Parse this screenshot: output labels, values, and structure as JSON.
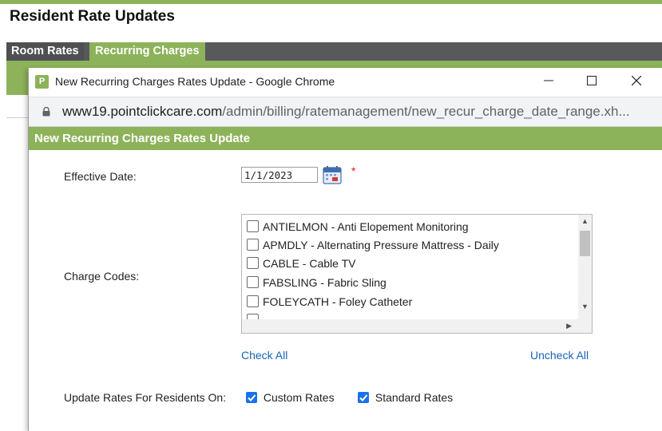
{
  "page": {
    "title": "Resident Rate Updates"
  },
  "tabs": [
    {
      "label": "Room Rates"
    },
    {
      "label": "Recurring Charges"
    }
  ],
  "chrome": {
    "title": "New Recurring Charges Rates Update - Google Chrome",
    "favicon": "P",
    "url_host": "www19.pointclickcare.com",
    "url_path": "/admin/billing/ratemanagement/new_recur_charge_date_range.xh...",
    "minimize": "—",
    "maximize": "☐",
    "close": "✕"
  },
  "form": {
    "header": "New Recurring Charges Rates Update",
    "effective_date_label": "Effective Date:",
    "effective_date_value": "1/1/2023",
    "required_mark": "*",
    "charge_codes_label": "Charge Codes:",
    "charge_codes": [
      {
        "label": "ANTIELMON - Anti Elopement Monitoring",
        "checked": false
      },
      {
        "label": "APMDLY - Alternating Pressure Mattress - Daily",
        "checked": false
      },
      {
        "label": "CABLE - Cable TV",
        "checked": false
      },
      {
        "label": "FABSLING - Fabric Sling",
        "checked": false
      },
      {
        "label": "FOLEYCATH - Foley Catheter",
        "checked": false
      }
    ],
    "check_all": "Check All",
    "uncheck_all": "Uncheck All",
    "update_rates_label": "Update Rates For Residents On:",
    "custom_rates": {
      "label": "Custom Rates",
      "checked": true
    },
    "standard_rates": {
      "label": "Standard Rates",
      "checked": true
    }
  },
  "colors": {
    "accent": "#8db35a",
    "link": "#1a63b8",
    "checkbox": "#1a73e8"
  }
}
